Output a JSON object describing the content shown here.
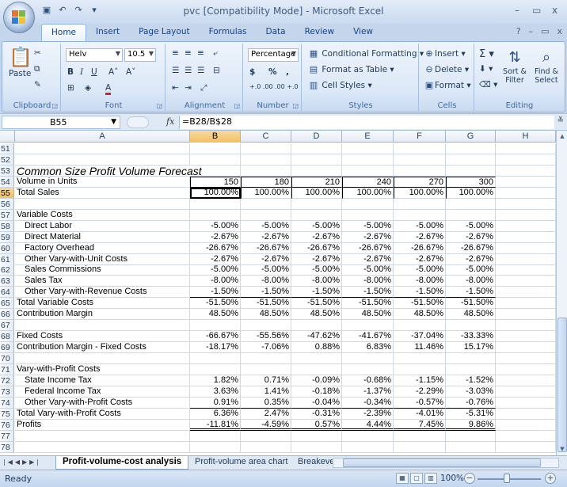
{
  "window": {
    "title": "pvc  [Compatibility Mode] - Microsoft Excel",
    "minimize": "–",
    "restore": "▭",
    "close": "x"
  },
  "tabs": [
    "Home",
    "Insert",
    "Page Layout",
    "Formulas",
    "Data",
    "Review",
    "View"
  ],
  "ribbon": {
    "clipboard": {
      "paste_label": "Paste",
      "group_label": "Clipboard"
    },
    "font": {
      "name": "Helv",
      "size": "10.5",
      "group_label": "Font"
    },
    "alignment": {
      "group_label": "Alignment"
    },
    "number": {
      "format": "Percentage",
      "currency": "$",
      "percent": "%",
      "comma": ",",
      "inc_decimal": "+.0 .00",
      "dec_decimal": ".00 +.0",
      "group_label": "Number"
    },
    "styles": {
      "conditional": "Conditional Formatting",
      "format_table": "Format as Table",
      "cell_styles": "Cell Styles",
      "group_label": "Styles"
    },
    "cells": {
      "insert": "Insert",
      "delete": "Delete",
      "format": "Format",
      "group_label": "Cells"
    },
    "editing": {
      "sort_filter": "Sort & Filter",
      "find_select": "Find & Select",
      "sort_l1": "Sort &",
      "sort_l2": "Filter",
      "find_l1": "Find &",
      "find_l2": "Select",
      "group_label": "Editing"
    }
  },
  "formula_bar": {
    "name_box": "B55",
    "fx": "fx",
    "formula": "=B28/B$28"
  },
  "columns": [
    "A",
    "B",
    "C",
    "D",
    "E",
    "F",
    "G",
    "H"
  ],
  "sheet": {
    "title": "Common Size Profit Volume Forecast",
    "rows": [
      {
        "n": "51",
        "label": "",
        "indent": false,
        "values": []
      },
      {
        "n": "52",
        "label": "",
        "indent": false,
        "values": []
      },
      {
        "n": "53",
        "label": "",
        "indent": false,
        "values": []
      },
      {
        "n": "54",
        "label": "Volume in Units",
        "indent": false,
        "values": [
          "150",
          "180",
          "210",
          "240",
          "270",
          "300"
        ]
      },
      {
        "n": "55",
        "label": "Total Sales",
        "indent": false,
        "values": [
          "100.00%",
          "100.00%",
          "100.00%",
          "100.00%",
          "100.00%",
          "100.00%"
        ]
      },
      {
        "n": "56",
        "label": "",
        "indent": false,
        "values": []
      },
      {
        "n": "57",
        "label": "Variable Costs",
        "indent": false,
        "values": []
      },
      {
        "n": "58",
        "label": "Direct Labor",
        "indent": true,
        "values": [
          "-5.00%",
          "-5.00%",
          "-5.00%",
          "-5.00%",
          "-5.00%",
          "-5.00%"
        ]
      },
      {
        "n": "59",
        "label": "Direct Material",
        "indent": true,
        "values": [
          "-2.67%",
          "-2.67%",
          "-2.67%",
          "-2.67%",
          "-2.67%",
          "-2.67%"
        ]
      },
      {
        "n": "60",
        "label": "Factory Overhead",
        "indent": true,
        "values": [
          "-26.67%",
          "-26.67%",
          "-26.67%",
          "-26.67%",
          "-26.67%",
          "-26.67%"
        ]
      },
      {
        "n": "61",
        "label": "Other Vary-with-Unit Costs",
        "indent": true,
        "values": [
          "-2.67%",
          "-2.67%",
          "-2.67%",
          "-2.67%",
          "-2.67%",
          "-2.67%"
        ]
      },
      {
        "n": "62",
        "label": "Sales Commissions",
        "indent": true,
        "values": [
          "-5.00%",
          "-5.00%",
          "-5.00%",
          "-5.00%",
          "-5.00%",
          "-5.00%"
        ]
      },
      {
        "n": "63",
        "label": "Sales Tax",
        "indent": true,
        "values": [
          "-8.00%",
          "-8.00%",
          "-8.00%",
          "-8.00%",
          "-8.00%",
          "-8.00%"
        ]
      },
      {
        "n": "64",
        "label": "Other Vary-with-Revenue Costs",
        "indent": true,
        "values": [
          "-1.50%",
          "-1.50%",
          "-1.50%",
          "-1.50%",
          "-1.50%",
          "-1.50%"
        ]
      },
      {
        "n": "65",
        "label": "Total Variable Costs",
        "indent": false,
        "values": [
          "-51.50%",
          "-51.50%",
          "-51.50%",
          "-51.50%",
          "-51.50%",
          "-51.50%"
        ]
      },
      {
        "n": "66",
        "label": "Contribution Margin",
        "indent": false,
        "values": [
          "48.50%",
          "48.50%",
          "48.50%",
          "48.50%",
          "48.50%",
          "48.50%"
        ]
      },
      {
        "n": "67",
        "label": "",
        "indent": false,
        "values": []
      },
      {
        "n": "68",
        "label": "Fixed Costs",
        "indent": false,
        "values": [
          "-66.67%",
          "-55.56%",
          "-47.62%",
          "-41.67%",
          "-37.04%",
          "-33.33%"
        ]
      },
      {
        "n": "69",
        "label": "Contribution Margin - Fixed Costs",
        "indent": false,
        "values": [
          "-18.17%",
          "-7.06%",
          "0.88%",
          "6.83%",
          "11.46%",
          "15.17%"
        ]
      },
      {
        "n": "70",
        "label": "",
        "indent": false,
        "values": []
      },
      {
        "n": "71",
        "label": "Vary-with-Profit Costs",
        "indent": false,
        "values": []
      },
      {
        "n": "72",
        "label": "State Income Tax",
        "indent": true,
        "values": [
          "1.82%",
          "0.71%",
          "-0.09%",
          "-0.68%",
          "-1.15%",
          "-1.52%"
        ]
      },
      {
        "n": "73",
        "label": "Federal Income Tax",
        "indent": true,
        "values": [
          "3.63%",
          "1.41%",
          "-0.18%",
          "-1.37%",
          "-2.29%",
          "-3.03%"
        ]
      },
      {
        "n": "74",
        "label": "Other Vary-with-Profit Costs",
        "indent": true,
        "values": [
          "0.91%",
          "0.35%",
          "-0.04%",
          "-0.34%",
          "-0.57%",
          "-0.76%"
        ]
      },
      {
        "n": "75",
        "label": "Total Vary-with-Profit Costs",
        "indent": false,
        "values": [
          "6.36%",
          "2.47%",
          "-0.31%",
          "-2.39%",
          "-4.01%",
          "-5.31%"
        ]
      },
      {
        "n": "76",
        "label": "Profits",
        "indent": false,
        "values": [
          "-11.81%",
          "-4.59%",
          "0.57%",
          "4.44%",
          "7.45%",
          "9.86%"
        ]
      },
      {
        "n": "77",
        "label": "",
        "indent": false,
        "values": []
      },
      {
        "n": "78",
        "label": "",
        "indent": false,
        "values": []
      }
    ]
  },
  "sheet_tabs": [
    "Profit-volume-cost analysis",
    "Profit-volume area chart",
    "Breakeve"
  ],
  "status": {
    "ready": "Ready",
    "zoom": "100%"
  }
}
